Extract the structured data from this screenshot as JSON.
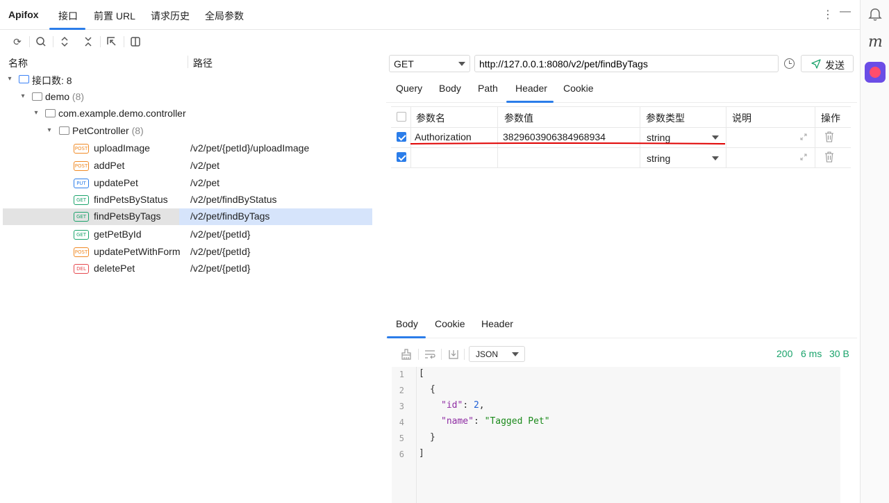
{
  "topbar": {
    "brand": "Apifox",
    "tabs": [
      "接口",
      "前置 URL",
      "请求历史",
      "全局参数"
    ],
    "active_tab": "接口",
    "more_icon": "more-vertical-icon",
    "minimize_icon": "minimize-icon"
  },
  "rightbar": {
    "bell_icon": "bell-icon",
    "m_label": "m",
    "app_icon": "apifox-app-icon"
  },
  "tree": {
    "toolbar_icons": [
      "refresh-icon",
      "search-icon",
      "expand-all-icon",
      "collapse-all-icon",
      "locate-icon",
      "split-view-icon"
    ],
    "col_name": "名称",
    "col_path": "路径",
    "root_label": "接口数: 8",
    "module_label": "demo",
    "module_count": "(8)",
    "package_label": "com.example.demo.controller",
    "controller_label": "PetController",
    "controller_count": "(8)",
    "endpoints": [
      {
        "method": "POST",
        "name": "uploadImage",
        "path": "/v2/pet/{petId}/uploadImage"
      },
      {
        "method": "POST",
        "name": "addPet",
        "path": "/v2/pet"
      },
      {
        "method": "PUT",
        "name": "updatePet",
        "path": "/v2/pet"
      },
      {
        "method": "GET",
        "name": "findPetsByStatus",
        "path": "/v2/pet/findByStatus"
      },
      {
        "method": "GET",
        "name": "findPetsByTags",
        "path": "/v2/pet/findByTags"
      },
      {
        "method": "GET",
        "name": "getPetById",
        "path": "/v2/pet/{petId}"
      },
      {
        "method": "POST",
        "name": "updatePetWithForm",
        "path": "/v2/pet/{petId}"
      },
      {
        "method": "DEL",
        "name": "deletePet",
        "path": "/v2/pet/{petId}"
      }
    ],
    "selected_endpoint": "findPetsByTags"
  },
  "request": {
    "method": "GET",
    "url": "http://127.0.0.1:8080/v2/pet/findByTags",
    "send_label": "发送",
    "tabs": [
      "Query",
      "Body",
      "Path",
      "Header",
      "Cookie"
    ],
    "active_tab": "Header",
    "params": {
      "headers": [
        "参数名",
        "参数值",
        "参数类型",
        "说明",
        "操作"
      ],
      "rows": [
        {
          "checked": true,
          "name": "Authorization",
          "value": "3829603906384968934",
          "type": "string",
          "desc": ""
        },
        {
          "checked": true,
          "name": "",
          "value": "",
          "type": "string",
          "desc": ""
        }
      ]
    },
    "highlight_color": "#e00000"
  },
  "response": {
    "tabs": [
      "Body",
      "Cookie",
      "Header"
    ],
    "active_tab": "Body",
    "toolbar_icons": [
      "clear-icon",
      "wrap-icon",
      "download-icon"
    ],
    "format": "JSON",
    "status": "200",
    "time": "6 ms",
    "size": "30 B",
    "line_numbers": [
      "1",
      "2",
      "3",
      "4",
      "5",
      "6"
    ],
    "body": {
      "open_bracket": "[",
      "open_brace": "{",
      "id_key": "\"id\"",
      "id_value": "2",
      "name_key": "\"name\"",
      "name_value": "\"Tagged Pet\"",
      "close_brace": "}",
      "close_bracket": "]"
    }
  },
  "colors": {
    "accent": "#2b7de9",
    "success": "#1aa36b",
    "post": "#f08a24",
    "get": "#1aa36b",
    "put": "#2b7de9",
    "delete": "#e5484d"
  }
}
